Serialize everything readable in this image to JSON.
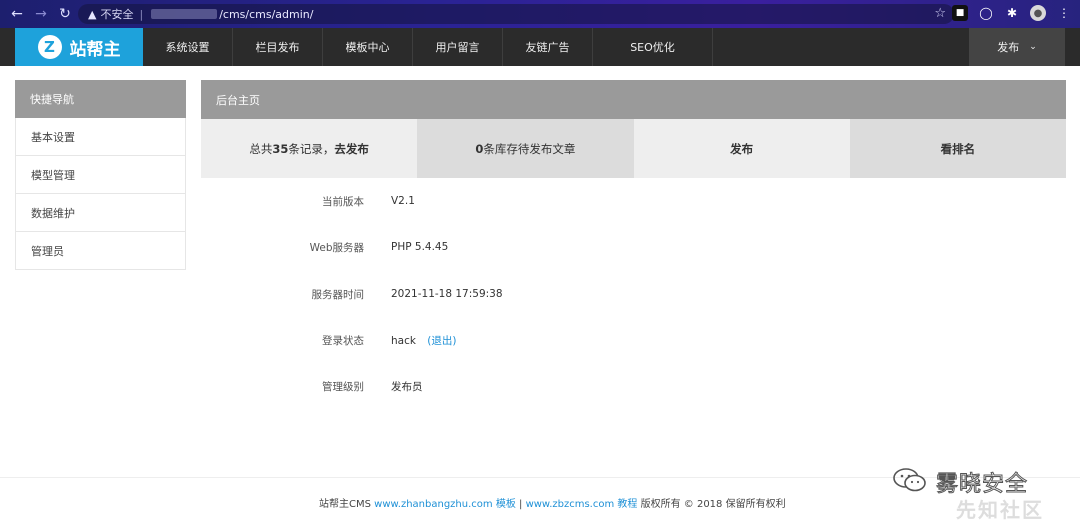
{
  "browser": {
    "security_label": "不安全",
    "separator": "|",
    "url_path": "/cms/cms/admin/"
  },
  "topbar": {
    "logo_letter": "Z",
    "logo_text": "站帮主",
    "menu": [
      "系统设置",
      "栏目发布",
      "模板中心",
      "用户留言",
      "友链广告",
      "SEO优化"
    ],
    "publish_label": "发布"
  },
  "sidebar": {
    "title": "快捷导航",
    "items": [
      "基本设置",
      "模型管理",
      "数据维护",
      "管理员"
    ]
  },
  "main": {
    "title": "后台主页",
    "stats": {
      "s1_prefix": "总共",
      "s1_count": "35",
      "s1_mid": "条记录，",
      "s1_action": "去发布",
      "s2_count": "0",
      "s2_text": "条库存待发布文章",
      "s3": "发布",
      "s4": "看排名"
    },
    "info": [
      {
        "label": "当前版本",
        "value": "V2.1"
      },
      {
        "label": "Web服务器",
        "value": "PHP 5.4.45"
      },
      {
        "label": "服务器时间",
        "value": "2021-11-18 17:59:38"
      },
      {
        "label": "登录状态",
        "value": "hack"
      },
      {
        "label": "管理级别",
        "value": "发布员"
      }
    ],
    "logout_label": "(退出)"
  },
  "footer": {
    "brand": "站帮主CMS",
    "link1": "www.zhanbangzhu.com",
    "link1_tail": "模板",
    "sep": "|",
    "link2": "www.zbzcms.com",
    "link2_tail": "教程",
    "copyright": "版权所有 © 2018 保留所有权利"
  },
  "watermark": {
    "text": "雾晓安全",
    "sub": "先知社区"
  }
}
